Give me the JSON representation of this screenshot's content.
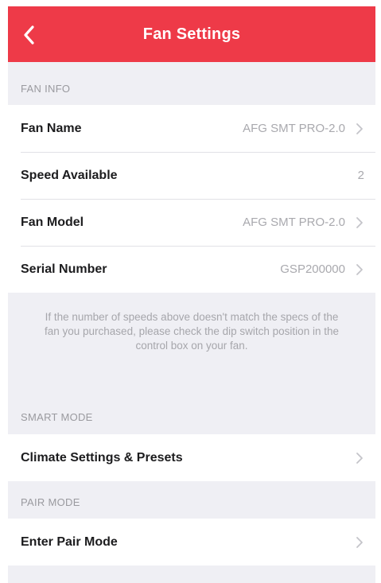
{
  "header": {
    "title": "Fan Settings"
  },
  "fan_info": {
    "section_title": "FAN INFO",
    "rows": [
      {
        "label": "Fan Name",
        "value": "AFG SMT PRO-2.0"
      },
      {
        "label": "Speed Available",
        "value": "2"
      },
      {
        "label": "Fan Model",
        "value": "AFG SMT PRO-2.0"
      },
      {
        "label": "Serial Number",
        "value": "GSP200000"
      }
    ],
    "note": "If the number of speeds above doesn't match the specs of the fan you purchased, please check the dip switch position in the control box on your fan."
  },
  "smart_mode": {
    "section_title": "SMART MODE",
    "row_label": "Climate Settings & Presets"
  },
  "pair_mode": {
    "section_title": "PAIR MODE",
    "row_label": "Enter Pair Mode"
  },
  "colors": {
    "accent": "#ee3a48",
    "background": "#efeff4",
    "secondary_text": "#a9a9ae"
  }
}
